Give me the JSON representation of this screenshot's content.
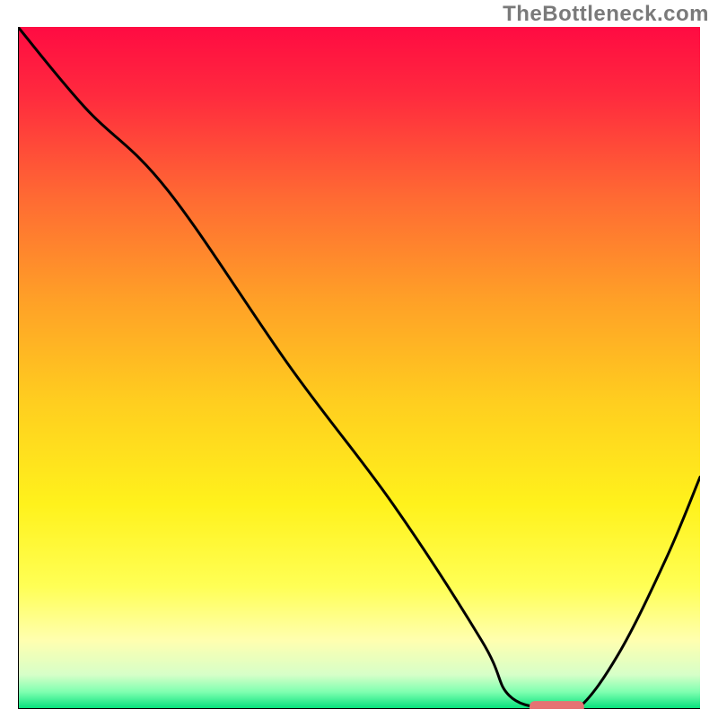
{
  "watermark": "TheBottleneck.com",
  "chart_data": {
    "type": "line",
    "title": "",
    "xlabel": "",
    "ylabel": "",
    "xlim": [
      0,
      100
    ],
    "ylim": [
      0,
      100
    ],
    "grid": false,
    "legend": false,
    "annotations": [],
    "background": {
      "type": "vertical-gradient",
      "stops": [
        {
          "offset": 0.0,
          "color": "#ff0b42"
        },
        {
          "offset": 0.1,
          "color": "#ff2a3e"
        },
        {
          "offset": 0.25,
          "color": "#ff6a33"
        },
        {
          "offset": 0.4,
          "color": "#ffa027"
        },
        {
          "offset": 0.55,
          "color": "#ffce1f"
        },
        {
          "offset": 0.7,
          "color": "#fff21c"
        },
        {
          "offset": 0.82,
          "color": "#ffff55"
        },
        {
          "offset": 0.9,
          "color": "#ffffb0"
        },
        {
          "offset": 0.95,
          "color": "#d6ffc8"
        },
        {
          "offset": 0.975,
          "color": "#7fffb0"
        },
        {
          "offset": 1.0,
          "color": "#00e07a"
        }
      ]
    },
    "series": [
      {
        "name": "bottleneck-curve",
        "color": "#000000",
        "x": [
          0,
          10,
          22,
          40,
          55,
          68,
          72,
          78,
          82,
          88,
          95,
          100
        ],
        "y": [
          100,
          88,
          76,
          50,
          30,
          10,
          2,
          0,
          0,
          8,
          22,
          34
        ]
      }
    ],
    "marker": {
      "name": "optimal-range",
      "color": "#e57373",
      "x_start": 75,
      "x_end": 83,
      "y": 0,
      "thickness_pct": 1.8
    }
  }
}
